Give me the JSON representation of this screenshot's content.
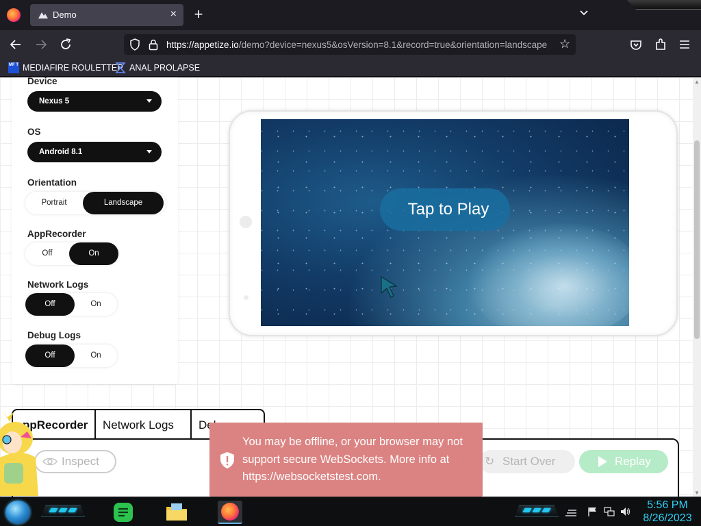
{
  "browser": {
    "tab_title": "Demo",
    "url_main": "https://appetize.io",
    "url_rest": "/demo?device=nexus5&osVersion=8.1&record=true&orientation=landscape",
    "bookmarks": [
      "MEDIAFIRE ROULETTER",
      "ANAL PROLAPSE"
    ],
    "bookmark_badge": "MF T"
  },
  "settings": {
    "device_label": "Device",
    "device_value": "Nexus 5",
    "os_label": "OS",
    "os_value": "Android 8.1",
    "orientation_label": "Orientation",
    "orientation_options": [
      "Portrait",
      "Landscape"
    ],
    "orientation_selected": "Landscape",
    "apprecorder_label": "AppRecorder",
    "apprecorder_options": [
      "Off",
      "On"
    ],
    "apprecorder_selected": "On",
    "network_label": "Network Logs",
    "network_options": [
      "Off",
      "On"
    ],
    "network_selected": "Off",
    "debug_label": "Debug Logs",
    "debug_options": [
      "Off",
      "On"
    ],
    "debug_selected": "Off"
  },
  "device_screen": {
    "play_label": "Tap to Play"
  },
  "bottom_tabs": [
    "ppRecorder",
    "Network Logs",
    "Debug Logs"
  ],
  "actions": {
    "inspect": "Inspect",
    "start_over": "Start Over",
    "replay": "Replay"
  },
  "toast": {
    "message": "You may be offline, or your browser may not support secure WebSockets. More info at https://websocketstest.com."
  },
  "taskbar": {
    "time": "5:56 PM",
    "date": "8/26/2023"
  },
  "colors": {
    "toast_bg": "#db8382",
    "replay_bg": "#b6ebc7",
    "clock": "#2fd0f5"
  }
}
